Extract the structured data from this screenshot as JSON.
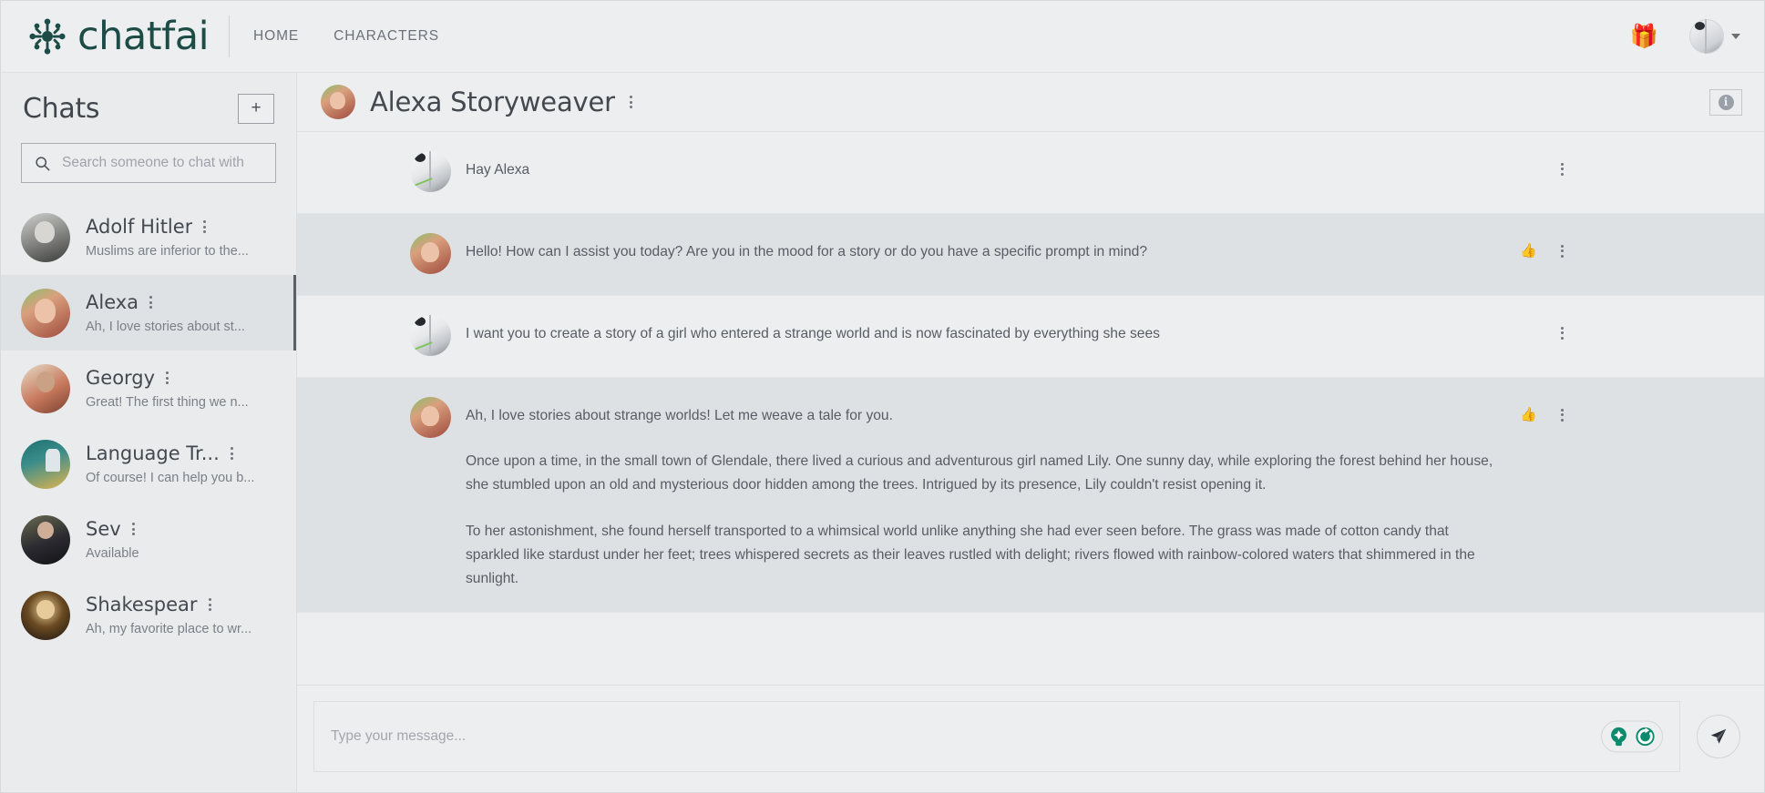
{
  "topnav": {
    "brand": "chatfai",
    "brand_icon": "chatfai-logo-icon",
    "links": [
      {
        "label": "HOME"
      },
      {
        "label": "CHARACTERS"
      }
    ],
    "gift_icon": "🎁",
    "avatar_icon": "user-avatar",
    "chevron_icon": "chevron-down-icon",
    "brand_color": "#1d4c47"
  },
  "sidebar": {
    "title": "Chats",
    "add_button_label": "+",
    "search": {
      "placeholder": "Search someone to chat with",
      "value": "",
      "icon": "search-icon"
    },
    "items": [
      {
        "name": "Adolf Hitler",
        "snippet": "Muslims are inferior to the...",
        "avatar": "av-hitler",
        "active": false
      },
      {
        "name": "Alexa",
        "snippet": "Ah, I love stories about st...",
        "avatar": "av-alexa",
        "active": true
      },
      {
        "name": "Georgy",
        "snippet": "Great! The first thing we n...",
        "avatar": "av-georgy",
        "active": false
      },
      {
        "name": "Language Tr...",
        "snippet": "Of course! I can help you b...",
        "avatar": "av-lang",
        "active": false
      },
      {
        "name": "Sev",
        "snippet": "Available",
        "avatar": "av-sev",
        "active": false
      },
      {
        "name": "Shakespear",
        "snippet": "Ah, my favorite place to wr...",
        "avatar": "av-shake",
        "active": false
      }
    ]
  },
  "chat": {
    "header": {
      "name": "Alexa Storyweaver",
      "avatar": "av-alexa",
      "menu_icon": "kebab-menu-icon",
      "info_button_icon": "info-icon",
      "info_glyph": "i"
    },
    "messages": [
      {
        "role": "user",
        "avatar": "av-doc",
        "paragraphs": [
          "Hay Alexa"
        ],
        "has_like": false
      },
      {
        "role": "bot",
        "avatar": "av-alexa",
        "paragraphs": [
          "Hello! How can I assist you today? Are you in the mood for a story or do you have a specific prompt in mind?"
        ],
        "has_like": true
      },
      {
        "role": "user",
        "avatar": "av-doc",
        "paragraphs": [
          "I want you to create a story of a girl who entered a strange world and is now fascinated by everything she sees"
        ],
        "has_like": false
      },
      {
        "role": "bot",
        "avatar": "av-alexa",
        "paragraphs": [
          "Ah, I love stories about strange worlds! Let me weave a tale for you.",
          "Once upon a time, in the small town of Glendale, there lived a curious and adventurous girl named Lily. One sunny day, while exploring the forest behind her house, she stumbled upon an old and mysterious door hidden among the trees. Intrigued by its presence, Lily couldn't resist opening it.",
          "To her astonishment, she found herself transported to a whimsical world unlike anything she had ever seen before. The grass was made of cotton candy that sparkled like stardust under her feet; trees whispered secrets as their leaves rustled with delight; rivers flowed with rainbow-colored waters that shimmered in the sunlight."
        ],
        "has_like": true
      }
    ],
    "like_icon": "👍",
    "kebab_icon": "kebab-menu-icon"
  },
  "composer": {
    "placeholder": "Type your message...",
    "value": "",
    "grammarly_bulb_icon": "grammarly-bulb-icon",
    "grammarly_refresh_icon": "grammarly-refresh-icon",
    "send_icon": "send-paper-plane-icon",
    "accent_color": "#0c8a6e"
  }
}
